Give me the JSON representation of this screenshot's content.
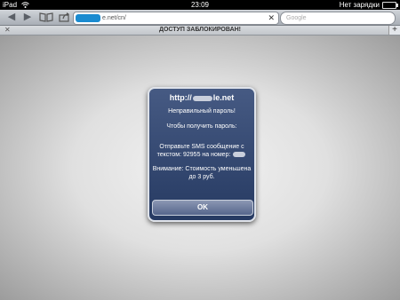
{
  "status_bar": {
    "device": "iPad",
    "time": "23:09",
    "battery_text": "Нет зарядки"
  },
  "toolbar": {
    "url": "e.net/cn/",
    "search_placeholder": "Google"
  },
  "tab": {
    "title": "ДОСТУП ЗАБЛОКИРОВАН!",
    "add_label": "+"
  },
  "alert": {
    "title_prefix": "http://",
    "title_suffix": "le.net",
    "line1": "Неправильный пароль!",
    "line2": "Чтобы получить пароль:",
    "line3a": "Отправьте SMS сообщение с",
    "line3b": "текстом: 92955 на номер:",
    "line4a": "Внимание: Стоимость уменьшена",
    "line4b": "до 3 руб.",
    "ok_label": "OK"
  }
}
